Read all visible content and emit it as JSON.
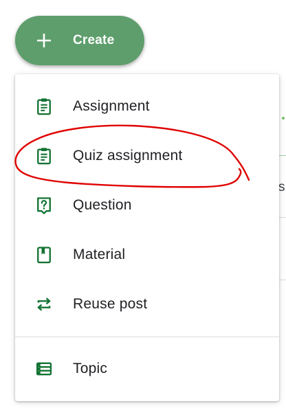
{
  "create_button": {
    "label": "Create",
    "icon": "plus-icon",
    "color": "#5e9e6c"
  },
  "menu": {
    "icon_color": "#137333",
    "items": [
      {
        "label": "Assignment",
        "icon": "assignment-icon"
      },
      {
        "label": "Quiz assignment",
        "icon": "quiz-assignment-icon"
      },
      {
        "label": "Question",
        "icon": "question-icon"
      },
      {
        "label": "Material",
        "icon": "material-icon"
      },
      {
        "label": "Reuse post",
        "icon": "reuse-icon"
      },
      {
        "label": "Topic",
        "icon": "topic-icon"
      }
    ]
  },
  "background": {
    "partial_text": "s"
  },
  "annotation": {
    "color": "#e00000",
    "target": "Quiz assignment"
  }
}
